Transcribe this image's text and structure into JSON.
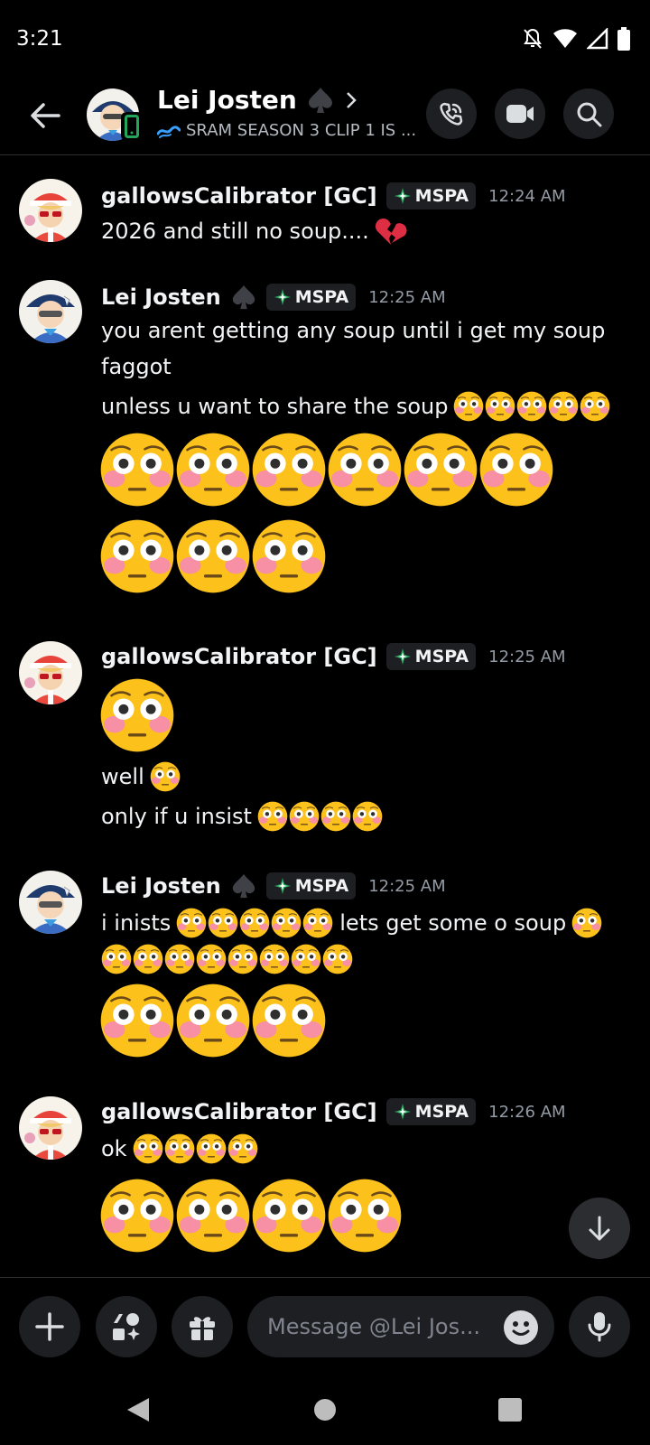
{
  "status_bar": {
    "time": "3:21"
  },
  "header": {
    "name": "Lei Josten",
    "status_text": "SRAM SEASON 3 CLIP 1 IS ..."
  },
  "guild_tag": "MSPA",
  "messages": [
    {
      "author": "gallowsCalibrator [GC]",
      "time": "12:24 AM",
      "lines": [
        {
          "text": "2026 and still no soup....",
          "emoji": "broken-heart"
        }
      ]
    },
    {
      "author": "Lei Josten",
      "time": "12:25 AM",
      "lines": [
        {
          "text": "you arent getting any soup until i get my soup"
        },
        {
          "text": "faggot"
        },
        {
          "text": "unless u want to share the soup",
          "small_flushed": 5
        }
      ],
      "big_flushed_rows": [
        6,
        3
      ]
    },
    {
      "author": "gallowsCalibrator [GC]",
      "time": "12:25 AM",
      "big_flushed_rows": [
        1
      ],
      "lines": [
        {
          "text": "well",
          "small_flushed": 1
        },
        {
          "text": "only if u insist",
          "small_flushed": 4
        }
      ]
    },
    {
      "author": "Lei Josten",
      "time": "12:25 AM",
      "lines": [
        {
          "text": "i inists",
          "small_flushed": 5,
          "text_after": "lets get some o soup",
          "small_flushed_after": 1
        },
        {
          "small_flushed": 8
        }
      ],
      "big_flushed_rows": [
        3
      ]
    },
    {
      "author": "gallowsCalibrator [GC]",
      "time": "12:26 AM",
      "lines": [
        {
          "text": "ok",
          "small_flushed": 4
        }
      ],
      "big_flushed_rows": [
        4
      ]
    }
  ],
  "composer": {
    "placeholder": "Message @Lei Jos..."
  },
  "colors": {
    "background": "#000000",
    "surface": "#1e1f22",
    "muted": "#949ba4",
    "tag_icon": "#23a55a"
  }
}
